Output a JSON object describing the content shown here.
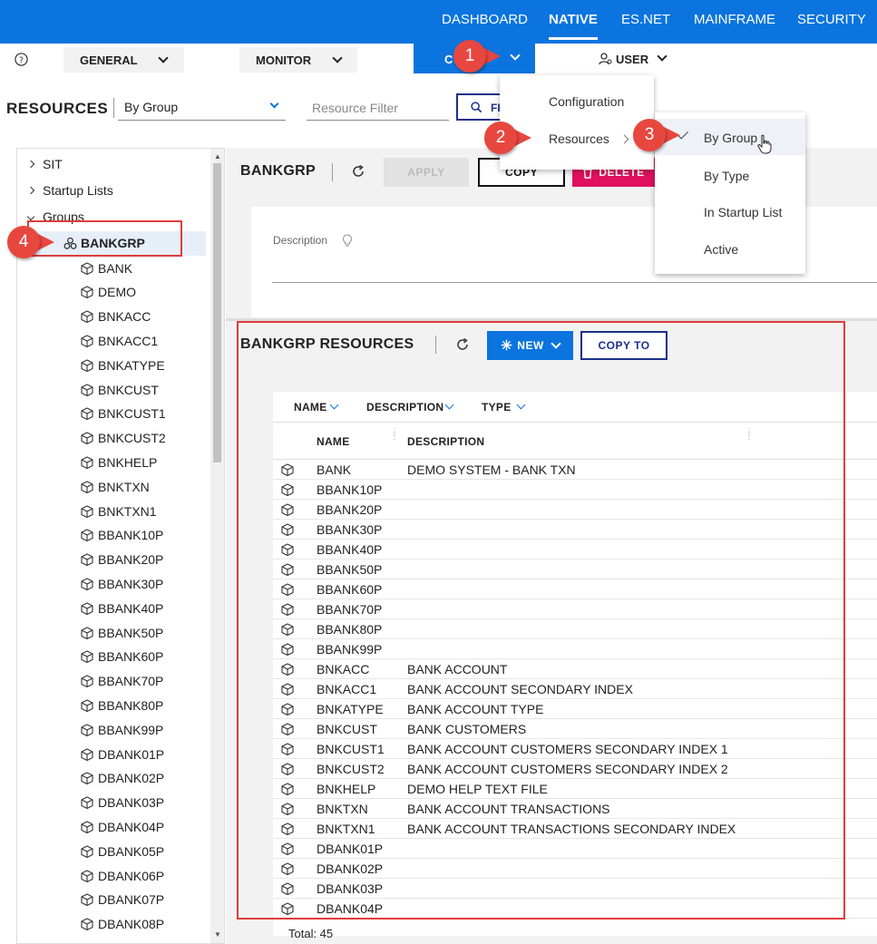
{
  "nav": {
    "items": [
      "DASHBOARD",
      "NATIVE",
      "ES.NET",
      "MAINFRAME",
      "SECURITY"
    ],
    "active": "NATIVE"
  },
  "subbar": {
    "general": "GENERAL",
    "monitor": "MONITOR",
    "config_partial": "C",
    "user": "USER"
  },
  "resources": {
    "title": "RESOURCES",
    "view": "By Group",
    "filter_placeholder": "Resource Filter",
    "find_partial": "FI"
  },
  "tree": {
    "top": [
      "SIT",
      "Startup Lists",
      "Groups"
    ],
    "selected": "BANKGRP",
    "leaves": [
      "BANK",
      "DEMO",
      "BNKACC",
      "BNKACC1",
      "BNKATYPE",
      "BNKCUST",
      "BNKCUST1",
      "BNKCUST2",
      "BNKHELP",
      "BNKTXN",
      "BNKTXN1",
      "BBANK10P",
      "BBANK20P",
      "BBANK30P",
      "BBANK40P",
      "BBANK50P",
      "BBANK60P",
      "BBANK70P",
      "BBANK80P",
      "BBANK99P",
      "DBANK01P",
      "DBANK02P",
      "DBANK03P",
      "DBANK04P",
      "DBANK05P",
      "DBANK06P",
      "DBANK07P",
      "DBANK08P"
    ]
  },
  "group": {
    "title": "BANKGRP",
    "apply": "APPLY",
    "copy": "COPY",
    "delete": "DELETE",
    "description_label": "Description"
  },
  "group_resources": {
    "title": "BANKGRP RESOURCES",
    "new": "NEW",
    "copy_to": "COPY TO",
    "sort_headers": [
      "NAME",
      "DESCRIPTION",
      "TYPE"
    ],
    "columns": [
      "NAME",
      "DESCRIPTION"
    ],
    "rows": [
      [
        "BANK",
        "DEMO SYSTEM - BANK TXN"
      ],
      [
        "BBANK10P",
        ""
      ],
      [
        "BBANK20P",
        ""
      ],
      [
        "BBANK30P",
        ""
      ],
      [
        "BBANK40P",
        ""
      ],
      [
        "BBANK50P",
        ""
      ],
      [
        "BBANK60P",
        ""
      ],
      [
        "BBANK70P",
        ""
      ],
      [
        "BBANK80P",
        ""
      ],
      [
        "BBANK99P",
        ""
      ],
      [
        "BNKACC",
        "BANK ACCOUNT"
      ],
      [
        "BNKACC1",
        "BANK ACCOUNT SECONDARY INDEX"
      ],
      [
        "BNKATYPE",
        "BANK ACCOUNT TYPE"
      ],
      [
        "BNKCUST",
        "BANK CUSTOMERS"
      ],
      [
        "BNKCUST1",
        "BANK ACCOUNT CUSTOMERS SECONDARY INDEX 1"
      ],
      [
        "BNKCUST2",
        "BANK ACCOUNT CUSTOMERS SECONDARY INDEX 2"
      ],
      [
        "BNKHELP",
        "DEMO HELP TEXT FILE"
      ],
      [
        "BNKTXN",
        "BANK ACCOUNT TRANSACTIONS"
      ],
      [
        "BNKTXN1",
        "BANK ACCOUNT TRANSACTIONS SECONDARY INDEX"
      ],
      [
        "DBANK01P",
        ""
      ],
      [
        "DBANK02P",
        ""
      ],
      [
        "DBANK03P",
        ""
      ],
      [
        "DBANK04P",
        ""
      ]
    ],
    "total": "Total: 45"
  },
  "menu_config": [
    "Configuration",
    "Resources"
  ],
  "menu_resources": [
    "By Group",
    "By Type",
    "In Startup List",
    "Active"
  ],
  "menu_resources_checked": "By Group",
  "callouts": [
    "1",
    "2",
    "3",
    "4"
  ],
  "colors": {
    "brand_blue": "#0b74de",
    "delete_red": "#e0115f",
    "callout_red": "#e8473f",
    "navy": "#1a2f8a"
  }
}
